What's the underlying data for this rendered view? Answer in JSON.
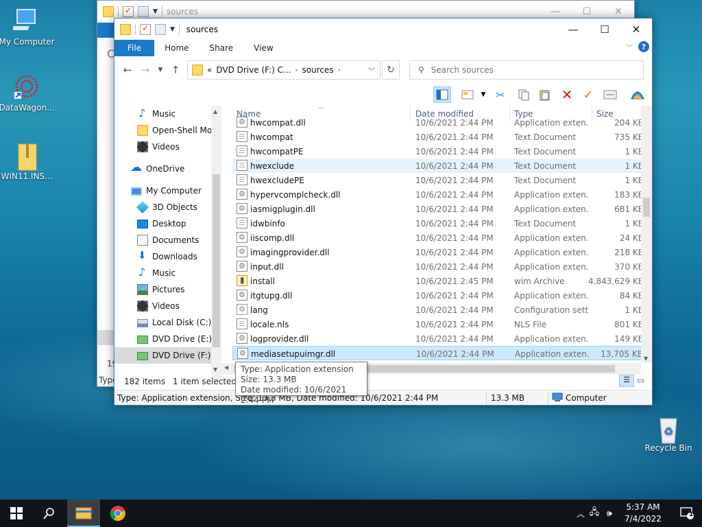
{
  "desktop": {
    "icons": [
      {
        "label": "My Computer",
        "icon": "computer-icon"
      },
      {
        "label": "DataWagon...",
        "icon": "datawagon-icon"
      },
      {
        "label": "WIN11.INS...",
        "icon": "zip-folder-icon"
      },
      {
        "label": "Recycle Bin",
        "icon": "recycle-bin-icon"
      }
    ]
  },
  "back_window": {
    "title": "sources",
    "side_letter": "C",
    "status_count": "19",
    "status_type": "Type"
  },
  "window": {
    "title": "sources",
    "controls": {
      "minimize": "—",
      "maximize": "☐",
      "close": "✕"
    },
    "ribbon_tabs": [
      "File",
      "Home",
      "Share",
      "View"
    ],
    "address": {
      "prefix": "«",
      "segments": [
        "DVD Drive (F:) C...",
        "sources"
      ]
    },
    "search": {
      "placeholder": "Search sources"
    },
    "nav_items": [
      {
        "label": "Music",
        "icon": "music-icon"
      },
      {
        "label": "Open-Shell Mod",
        "icon": "folder-icon"
      },
      {
        "label": "Videos",
        "icon": "videos-icon"
      },
      {
        "label": "OneDrive",
        "icon": "onedrive-icon"
      },
      {
        "label": "My Computer",
        "icon": "computer-icon"
      },
      {
        "label": "3D Objects",
        "icon": "3d-objects-icon"
      },
      {
        "label": "Desktop",
        "icon": "desktop-icon"
      },
      {
        "label": "Documents",
        "icon": "documents-icon"
      },
      {
        "label": "Downloads",
        "icon": "downloads-icon"
      },
      {
        "label": "Music",
        "icon": "music-icon"
      },
      {
        "label": "Pictures",
        "icon": "pictures-icon"
      },
      {
        "label": "Videos",
        "icon": "videos-icon"
      },
      {
        "label": "Local Disk (C:)",
        "icon": "local-disk-icon"
      },
      {
        "label": "DVD Drive (E:) C(",
        "icon": "dvd-drive-icon"
      },
      {
        "label": "DVD Drive (F:) C(",
        "icon": "dvd-drive-icon"
      }
    ],
    "columns": {
      "name": "Name",
      "date": "Date modified",
      "type": "Type",
      "size": "Size"
    },
    "files": [
      {
        "name": "hwcompat.dll",
        "date": "10/6/2021 2:44 PM",
        "type": "Application exten...",
        "size": "204 KB",
        "icon": "dll-file-icon"
      },
      {
        "name": "hwcompat",
        "date": "10/6/2021 2:44 PM",
        "type": "Text Document",
        "size": "735 KB",
        "icon": "text-file-icon"
      },
      {
        "name": "hwcompatPE",
        "date": "10/6/2021 2:44 PM",
        "type": "Text Document",
        "size": "1 KB",
        "icon": "text-file-icon"
      },
      {
        "name": "hwexclude",
        "date": "10/6/2021 2:44 PM",
        "type": "Text Document",
        "size": "1 KB",
        "icon": "text-file-icon"
      },
      {
        "name": "hwexcludePE",
        "date": "10/6/2021 2:44 PM",
        "type": "Text Document",
        "size": "1 KB",
        "icon": "text-file-icon"
      },
      {
        "name": "hypervcomplcheck.dll",
        "date": "10/6/2021 2:44 PM",
        "type": "Application exten...",
        "size": "183 KB",
        "icon": "dll-file-icon"
      },
      {
        "name": "iasmigplugin.dll",
        "date": "10/6/2021 2:44 PM",
        "type": "Application exten...",
        "size": "681 KB",
        "icon": "dll-file-icon"
      },
      {
        "name": "idwbinfo",
        "date": "10/6/2021 2:44 PM",
        "type": "Text Document",
        "size": "1 KB",
        "icon": "text-file-icon"
      },
      {
        "name": "iiscomp.dll",
        "date": "10/6/2021 2:44 PM",
        "type": "Application exten...",
        "size": "24 KB",
        "icon": "dll-file-icon"
      },
      {
        "name": "imagingprovider.dll",
        "date": "10/6/2021 2:44 PM",
        "type": "Application exten...",
        "size": "218 KB",
        "icon": "dll-file-icon"
      },
      {
        "name": "input.dll",
        "date": "10/6/2021 2:44 PM",
        "type": "Application exten...",
        "size": "370 KB",
        "icon": "dll-file-icon"
      },
      {
        "name": "install",
        "date": "10/6/2021 2:45 PM",
        "type": "wim Archive",
        "size": "4,843,629 KB",
        "icon": "wim-archive-icon"
      },
      {
        "name": "itgtupg.dll",
        "date": "10/6/2021 2:44 PM",
        "type": "Application exten...",
        "size": "84 KB",
        "icon": "dll-file-icon"
      },
      {
        "name": "lang",
        "date": "10/6/2021 2:44 PM",
        "type": "Configuration sett...",
        "size": "1 KB",
        "icon": "config-file-icon"
      },
      {
        "name": "locale.nls",
        "date": "10/6/2021 2:44 PM",
        "type": "NLS File",
        "size": "801 KB",
        "icon": "file-icon"
      },
      {
        "name": "logprovider.dll",
        "date": "10/6/2021 2:44 PM",
        "type": "Application exten...",
        "size": "149 KB",
        "icon": "dll-file-icon"
      },
      {
        "name": "mediasetupuimgr.dll",
        "date": "10/6/2021 2:44 PM",
        "type": "Application exten...",
        "size": "13,705 KB",
        "icon": "dll-file-icon"
      }
    ],
    "item_count": "182 items",
    "selected_info": "1 item selected  1",
    "status": {
      "details": "Type: Application extension, Size: 13.3 MB, Date modified: 10/6/2021 2:44 PM",
      "size": "13.3 MB",
      "location": "Computer"
    },
    "tooltip": {
      "type": "Type: Application extension",
      "size": "Size: 13.3 MB",
      "date": "Date modified: 10/6/2021 2:44 PM"
    }
  },
  "taskbar": {
    "time": "5:37 AM",
    "date": "7/4/2022",
    "notification_count": "1"
  },
  "colors": {
    "accent": "#1979ca",
    "selection": "#cce8ff",
    "taskbar": "#101418"
  }
}
